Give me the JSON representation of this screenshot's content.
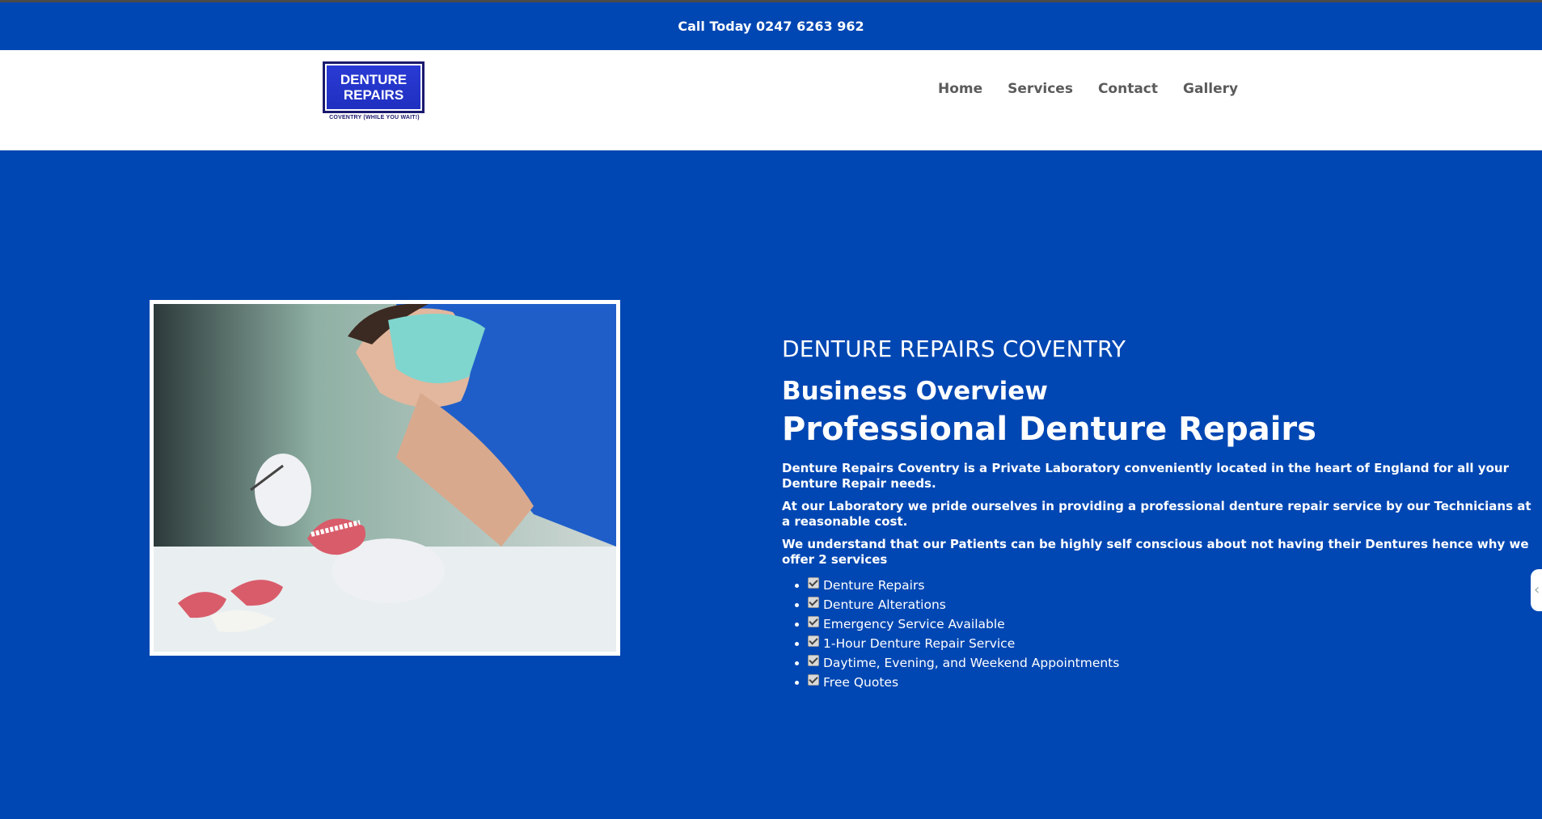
{
  "topbar": {
    "call_text": "Call Today 0247 6263 962"
  },
  "logo": {
    "line1": "DENTURE",
    "line2": "REPAIRS",
    "tagline": "COVENTRY (WHILE YOU WAIT!)"
  },
  "nav": {
    "items": [
      {
        "label": "Home"
      },
      {
        "label": "Services"
      },
      {
        "label": "Contact"
      },
      {
        "label": "Gallery"
      }
    ]
  },
  "content": {
    "kicker": "DENTURE REPAIRS COVENTRY",
    "subtitle": "Business Overview",
    "title": "Professional Denture Repairs",
    "paragraphs": [
      "Denture Repairs Coventry is a Private Laboratory conveniently located in the heart of England for all your Denture Repair needs.",
      "At our Laboratory we pride ourselves in providing a professional denture repair service by our Technicians at a reasonable cost.",
      "We understand that our Patients can be highly self conscious about not having their Dentures hence why we offer 2 services"
    ],
    "features": [
      "Denture Repairs",
      "Denture Alterations",
      "Emergency Service Available",
      "1-Hour Denture Repair Service",
      "Daytime, Evening, and Weekend Appointments",
      "Free Quotes"
    ]
  },
  "colors": {
    "brand_blue": "#0047b3",
    "nav_text": "#5b5b5b"
  }
}
